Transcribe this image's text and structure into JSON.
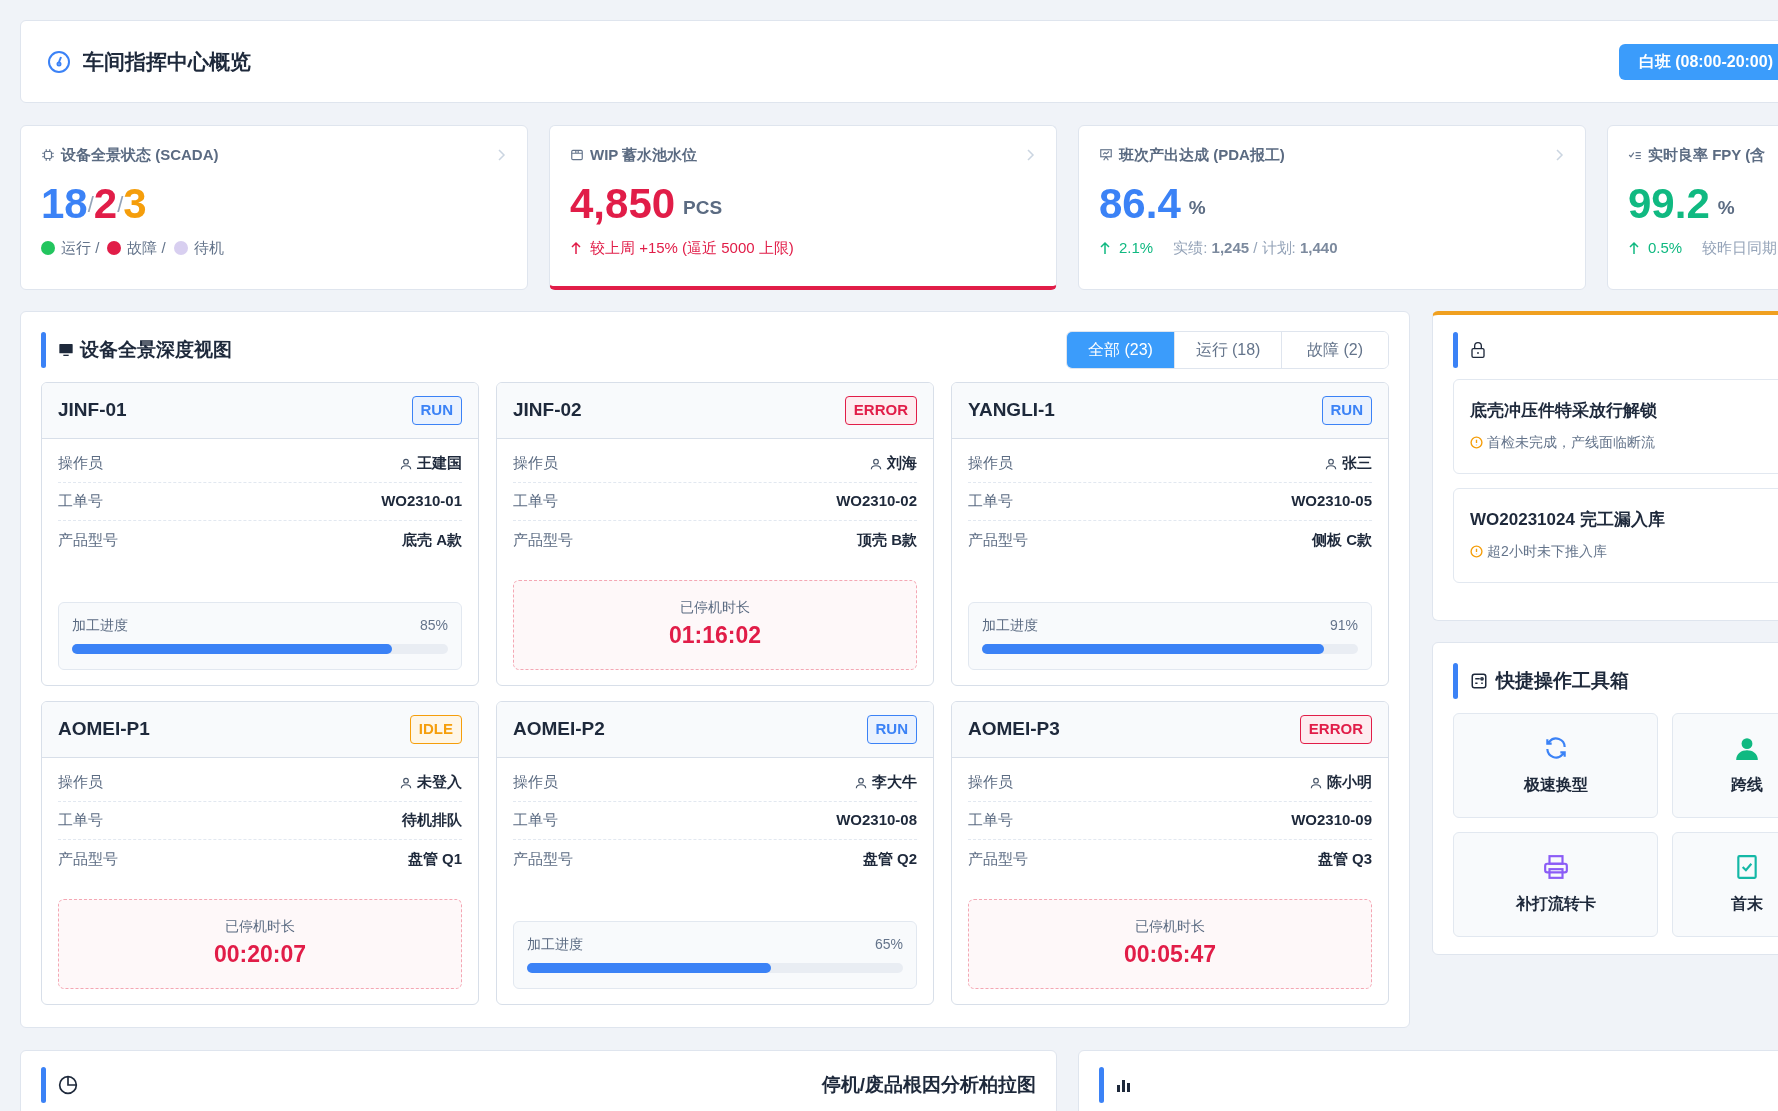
{
  "header": {
    "title": "车间指挥中心概览",
    "shift_button": "白班 (08:00-20:00)"
  },
  "kpis": [
    {
      "kind": "status",
      "title": "设备全景状态 (SCADA)",
      "alert": false,
      "counts": [
        {
          "value": "18",
          "color": "#3b82f6"
        },
        {
          "value": "2",
          "color": "#e11d48"
        },
        {
          "value": "3",
          "color": "#f59e0b"
        }
      ],
      "separator": "/",
      "legend": [
        {
          "label": "运行 /",
          "color": "#22c55e"
        },
        {
          "label": "故障 /",
          "color": "#e11d48"
        },
        {
          "label": "待机",
          "color": "#d8cff0"
        }
      ]
    },
    {
      "kind": "metric",
      "title": "WIP 蓄水池水位",
      "alert": true,
      "value": {
        "text": "4,850",
        "color": "#e11d48"
      },
      "unit": "PCS",
      "trend": {
        "text": "较上周 +15% (逼近 5000 上限)",
        "color": "#e11d48"
      }
    },
    {
      "kind": "metric",
      "title": "班次产出达成 (PDA报工)",
      "alert": false,
      "value": {
        "text": "86.4",
        "color": "#3b82f6"
      },
      "unit": "%",
      "trend": {
        "text": "2.1%",
        "color": "#10b981"
      },
      "note": "实绩: **1,245** / 计划: **1,440**"
    },
    {
      "kind": "metric",
      "title": "实时良率 FPY (含",
      "alert": false,
      "value": {
        "text": "99.2",
        "color": "#10b981"
      },
      "unit": "%",
      "trend": {
        "text": "0.5%",
        "color": "#10b981"
      },
      "note": "较昨日同期"
    }
  ],
  "devices_panel": {
    "title": "设备全景深度视图",
    "tabs": [
      {
        "label": "全部 (23)",
        "selected": true
      },
      {
        "label": "运行 (18)",
        "selected": false
      },
      {
        "label": "故障 (2)",
        "selected": false
      }
    ],
    "devices": [
      {
        "name": "JINF-01",
        "status": "RUN",
        "fields": [
          {
            "label": "操作员",
            "value": "王建国"
          },
          {
            "label": "工单号",
            "value": "WO2310-01"
          },
          {
            "label": "产品型号",
            "value": "底壳 A款"
          }
        ],
        "kind": "progress",
        "bottom_label": "加工进度",
        "level": 0.85,
        "reading": "85%"
      },
      {
        "name": "JINF-02",
        "status": "ERROR",
        "fields": [
          {
            "label": "操作员",
            "value": "刘海"
          },
          {
            "label": "工单号",
            "value": "WO2310-02"
          },
          {
            "label": "产品型号",
            "value": "顶壳 B款"
          }
        ],
        "kind": "downtime",
        "bottom_label": "已停机时长",
        "duration": "01:16:02"
      },
      {
        "name": "YANGLI-1",
        "status": "RUN",
        "fields": [
          {
            "label": "操作员",
            "value": "张三"
          },
          {
            "label": "工单号",
            "value": "WO2310-05"
          },
          {
            "label": "产品型号",
            "value": "侧板 C款"
          }
        ],
        "kind": "progress",
        "bottom_label": "加工进度",
        "level": 0.91,
        "reading": "91%"
      },
      {
        "name": "AOMEI-P1",
        "status": "IDLE",
        "fields": [
          {
            "label": "操作员",
            "value": "未登入"
          },
          {
            "label": "工单号",
            "value": "待机排队"
          },
          {
            "label": "产品型号",
            "value": "盘管 Q1"
          }
        ],
        "kind": "downtime",
        "bottom_label": "已停机时长",
        "duration": "00:20:07"
      },
      {
        "name": "AOMEI-P2",
        "status": "RUN",
        "fields": [
          {
            "label": "操作员",
            "value": "李大牛"
          },
          {
            "label": "工单号",
            "value": "WO2310-08"
          },
          {
            "label": "产品型号",
            "value": "盘管 Q2"
          }
        ],
        "kind": "progress",
        "bottom_label": "加工进度",
        "level": 0.65,
        "reading": "65%"
      },
      {
        "name": "AOMEI-P3",
        "status": "ERROR",
        "fields": [
          {
            "label": "操作员",
            "value": "陈小明"
          },
          {
            "label": "工单号",
            "value": "WO2310-09"
          },
          {
            "label": "产品型号",
            "value": "盘管 Q3"
          }
        ],
        "kind": "downtime",
        "bottom_label": "已停机时长",
        "duration": "00:05:47"
      }
    ]
  },
  "alerts_panel": {
    "items": [
      {
        "title": "底壳冲压件特采放行解锁",
        "note": "首检未完成，产线面临断流"
      },
      {
        "title": "WO20231024 完工漏入库",
        "note": "超2小时未下推入库"
      }
    ]
  },
  "toolbox": {
    "title": "快捷操作工具箱",
    "tools": [
      {
        "label": "极速换型"
      },
      {
        "label": "跨线"
      },
      {
        "label": "补打流转卡"
      },
      {
        "label": "首末"
      }
    ]
  },
  "bottom": {
    "pareto_title": "停机/废品根因分析柏拉图"
  }
}
